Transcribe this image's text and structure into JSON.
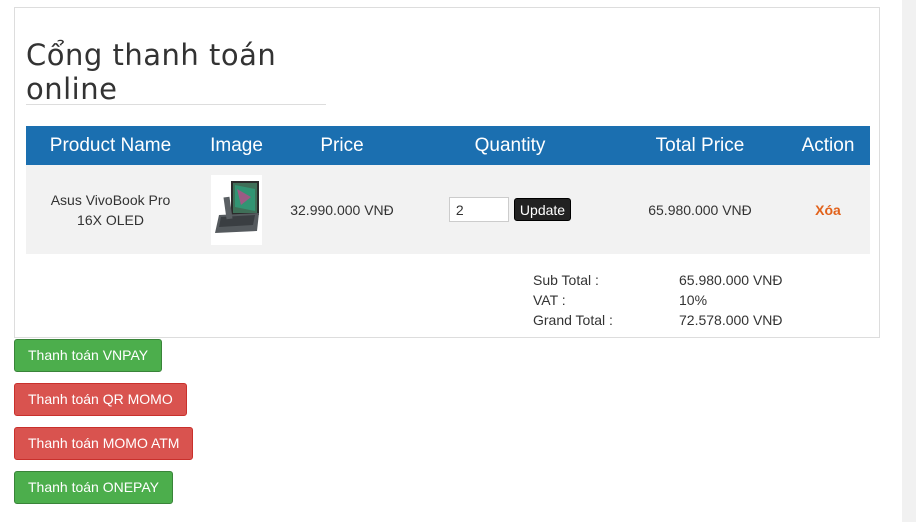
{
  "page": {
    "title": "Cổng thanh toán online"
  },
  "cart": {
    "headers": {
      "product_name": "Product Name",
      "image": "Image",
      "price": "Price",
      "quantity": "Quantity",
      "total_price": "Total Price",
      "action": "Action"
    },
    "items": [
      {
        "product_name": "Asus VivoBook Pro 16X OLED",
        "image_icon": "laptop-icon",
        "price": "32.990.000 VNĐ",
        "quantity": "2",
        "update_label": "Update",
        "total_price": "65.980.000 VNĐ",
        "delete_label": "Xóa"
      }
    ]
  },
  "summary": {
    "subtotal_label": "Sub Total :",
    "subtotal_value": "65.980.000 VNĐ",
    "vat_label": "VAT :",
    "vat_value": "10%",
    "grand_total_label": "Grand Total :",
    "grand_total_value": "72.578.000 VNĐ"
  },
  "payment_buttons": {
    "vnpay": "Thanh toán VNPAY",
    "qr_momo": "Thanh toán QR MOMO",
    "momo_atm": "Thanh toán MOMO ATM",
    "onepay": "Thanh toán ONEPAY"
  },
  "colors": {
    "header_blue": "#1b6fb0",
    "green": "#4cae4c",
    "red": "#d9534f",
    "delete_orange": "#e2621b"
  }
}
